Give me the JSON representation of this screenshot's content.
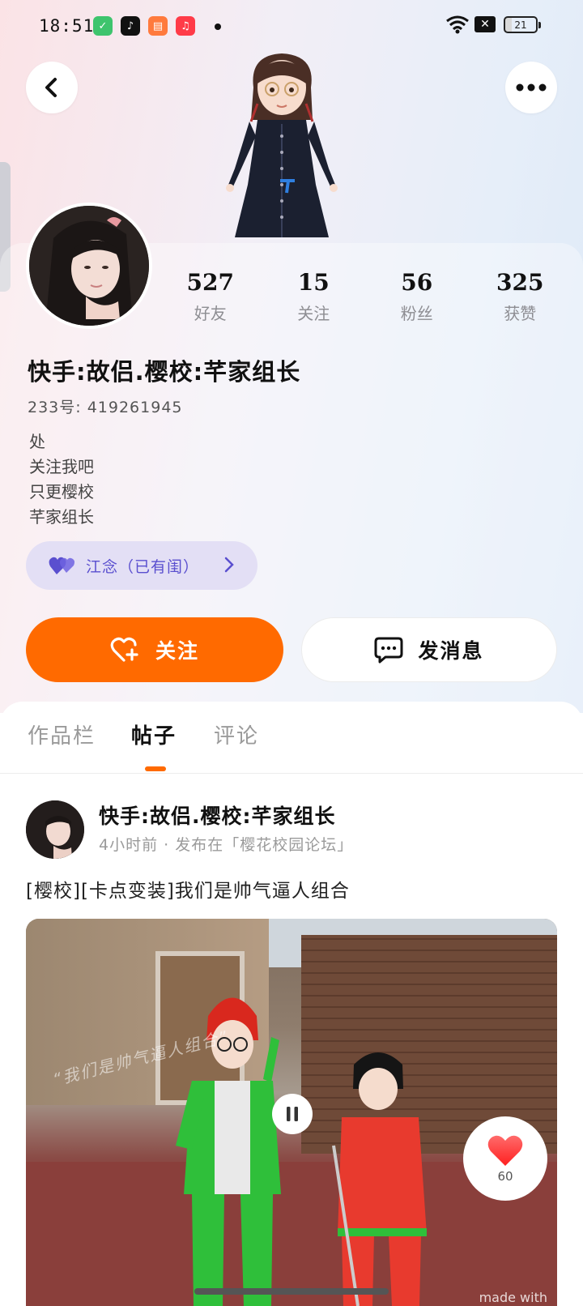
{
  "status_bar": {
    "time": "18:51",
    "battery": "21",
    "apps": [
      {
        "name": "shop-app-icon",
        "color": "#3ec46d"
      },
      {
        "name": "tiktok-app-icon",
        "color": "#111111"
      },
      {
        "name": "reader-app-icon",
        "color": "#ff7a3d"
      },
      {
        "name": "music-app-icon",
        "color": "#ff3b48"
      }
    ]
  },
  "profile": {
    "stats": [
      {
        "value": "527",
        "label": "好友"
      },
      {
        "value": "15",
        "label": "关注"
      },
      {
        "value": "56",
        "label": "粉丝"
      },
      {
        "value": "325",
        "label": "获赞"
      }
    ],
    "username": "快手:故侣.樱校:芊家组长",
    "uid": "233号: 419261945",
    "bio": [
      "处",
      "关注我吧",
      "只更樱校",
      "芊家组长"
    ],
    "family": {
      "label": "江念（已有闺）"
    }
  },
  "actions": {
    "follow_label": "关注",
    "message_label": "发消息"
  },
  "tabs": [
    {
      "label": "作品栏",
      "active": false
    },
    {
      "label": "帖子",
      "active": true
    },
    {
      "label": "评论",
      "active": false
    }
  ],
  "post": {
    "author": "快手:故侣.樱校:芊家组长",
    "meta": "4小时前 · 发布在「樱花校园论坛」",
    "text": "[樱校][卡点变装]我们是帅气逼人组合",
    "video": {
      "watermark": "“我们是帅气逼人组合”",
      "made_with": "made with",
      "likes": "60"
    }
  },
  "colors": {
    "accent": "#ff6a00",
    "family_purple": "#5a4fcf",
    "like_red": "#ff3b3b"
  }
}
